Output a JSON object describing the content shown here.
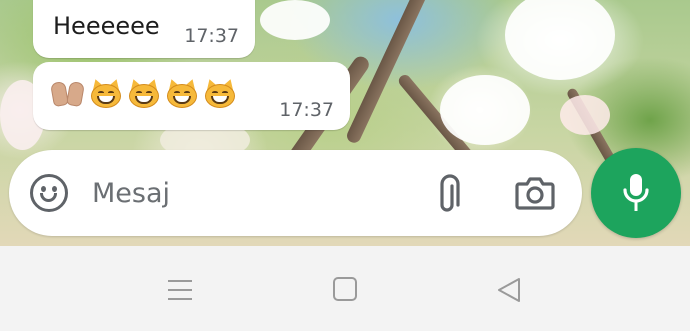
{
  "messages": [
    {
      "text": "Heeeeee",
      "time": "17:37"
    },
    {
      "emojis": [
        "palms-up-together",
        "grinning-cat",
        "grinning-cat",
        "grinning-cat",
        "grinning-cat"
      ],
      "time": "17:37"
    }
  ],
  "composer": {
    "placeholder": "Mesaj",
    "icons": [
      "emoji-icon",
      "attachment-icon",
      "camera-icon"
    ]
  },
  "mic_button": {
    "icon": "microphone-icon",
    "color": "#1da45d"
  },
  "nav_bar": {
    "icons": [
      "recent-apps-icon",
      "home-icon",
      "back-icon"
    ]
  }
}
